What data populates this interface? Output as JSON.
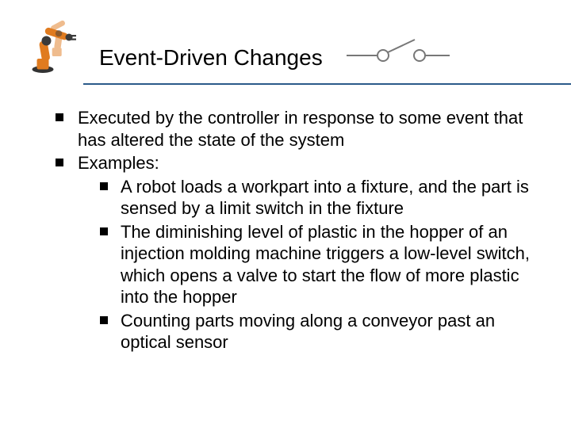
{
  "slide": {
    "title": "Event-Driven Changes",
    "bullets": [
      {
        "text": "Executed by the controller in response to some event that has altered the state of the system"
      },
      {
        "text": "Examples:",
        "children": [
          "A robot loads a workpart into a fixture, and the part is sensed by a limit switch in the fixture",
          "The diminishing level of plastic in the hopper of an injection molding machine triggers a low-level switch, which opens a valve to start the flow of more plastic into the hopper",
          "Counting parts moving along a conveyor past an optical sensor"
        ]
      }
    ]
  },
  "icons": {
    "robot_color_primary": "#e07b1f",
    "robot_color_dark": "#4a4a4a",
    "switch_color": "#777"
  }
}
